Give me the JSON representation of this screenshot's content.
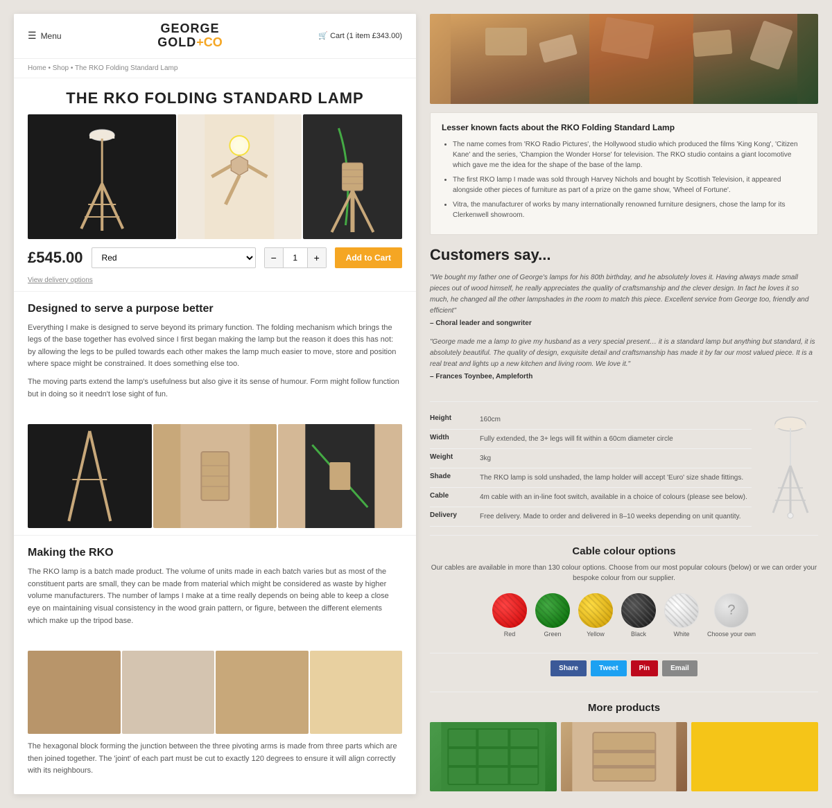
{
  "header": {
    "menu_label": "Menu",
    "logo_george": "GEORGE",
    "logo_gold": "GOLD",
    "logo_plus": "+",
    "logo_co": "CO",
    "cart_text": "Cart (1 item £343.00)"
  },
  "breadcrumb": {
    "home": "Home",
    "separator1": " • ",
    "shop": "Shop",
    "separator2": " • ",
    "current": "The RKO Folding Standard Lamp"
  },
  "product": {
    "title": "THE RKO FOLDING STANDARD LAMP",
    "price": "£545.00",
    "color_default": "Red",
    "qty_default": "1",
    "add_to_cart": "Add to Cart",
    "delivery_link": "View delivery options"
  },
  "section_purpose": {
    "heading": "Designed to serve a purpose better",
    "text1": "Everything I make is designed to serve beyond its primary function. The folding mechanism which brings the legs of the base together has evolved since I first began making the lamp but the reason it does this has not: by allowing the legs to be pulled towards each other makes the lamp much easier to move, store and position where space might be constrained. It does something else too.",
    "text2": "The moving parts extend the lamp's usefulness but also give it its sense of humour. Form might follow function but in doing so it needn't lose sight of fun."
  },
  "section_making": {
    "heading": "Making the RKO",
    "text1": "The RKO lamp is a batch made product. The volume of units made in each batch varies but as most of the constituent parts are small, they can be made from material which might be considered as waste by higher volume manufacturers. The number of lamps I make at a time really depends on being able to keep a close eye on maintaining visual consistency in the wood grain pattern, or figure, between the different elements which make up the tripod base.",
    "text2": "The hexagonal block forming the junction between the three pivoting arms is made from three parts which are then joined together. The 'joint' of each part must be cut to exactly 120 degrees to ensure it will align correctly with its neighbours."
  },
  "facts": {
    "title": "Lesser known facts about the RKO Folding Standard Lamp",
    "items": [
      "The name comes from 'RKO Radio Pictures', the Hollywood studio which produced the films 'King Kong', 'Citizen Kane' and the series, 'Champion the Wonder Horse' for television. The RKO studio contains a giant locomotive which gave me the idea for the shape of the base of the lamp.",
      "The first RKO lamp I made was sold through Harvey Nichols and bought by Scottish Television, it appeared alongside other pieces of furniture as part of a prize on the game show, 'Wheel of Fortune'.",
      "Vitra, the manufacturer of works by many internationally renowned furniture designers, chose the lamp for its Clerkenwell showroom."
    ]
  },
  "customers_say": {
    "title": "Customers say...",
    "reviews": [
      {
        "text": "\"We bought my father one of George's lamps for his 80th birthday, and he absolutely loves it. Having always made small pieces out of wood himself, he really appreciates the quality of craftsmanship and the clever design. In fact he loves it so much, he changed all the other lampshades in the room to match this piece. Excellent service from George too, friendly and efficient\"",
        "author": "– Choral leader and songwriter"
      },
      {
        "text": "\"George made me a lamp to give my husband as a very special present… it is a standard lamp but anything but standard, it is absolutely beautiful. The quality of design, exquisite detail and craftsmanship has made it by far our most valued piece. It is a real treat and lights up a new kitchen and living room. We love it.\"",
        "author": "– Frances Toynbee, Ampleforth"
      }
    ]
  },
  "specs": {
    "rows": [
      {
        "label": "Height",
        "value": "160cm"
      },
      {
        "label": "Width",
        "value": "Fully extended, the 3+ legs will fit within a 60cm diameter circle"
      },
      {
        "label": "Weight",
        "value": "3kg"
      },
      {
        "label": "Shade",
        "value": "The RKO lamp is sold unshaded, the lamp holder will accept 'Euro' size shade fittings."
      },
      {
        "label": "Cable",
        "value": "4m cable with an in-line foot switch, available in a choice of colours (please see below)."
      },
      {
        "label": "Delivery",
        "value": "Free delivery. Made to order and delivered in 8–10 weeks depending on unit quantity."
      }
    ]
  },
  "cable": {
    "title": "Cable colour options",
    "description": "Our cables are available in more than 130 colour options. Choose from our most popular colours (below) or we can order your bespoke colour from our supplier.",
    "options": [
      {
        "label": "Red",
        "class": "color-circle-red"
      },
      {
        "label": "Green",
        "class": "color-circle-green"
      },
      {
        "label": "Yellow",
        "class": "color-circle-yellow"
      },
      {
        "label": "Black",
        "class": "color-circle-black"
      },
      {
        "label": "White",
        "class": "color-circle-white"
      },
      {
        "label": "Choose your own",
        "class": "color-circle-custom"
      }
    ]
  },
  "share": {
    "buttons": [
      {
        "label": "Share",
        "class": "share-btn-fb"
      },
      {
        "label": "Tweet",
        "class": "share-btn-tw"
      },
      {
        "label": "Pin",
        "class": "share-btn-pin"
      },
      {
        "label": "Email",
        "class": "share-btn-em"
      }
    ]
  },
  "more_products": {
    "title": "More products"
  }
}
